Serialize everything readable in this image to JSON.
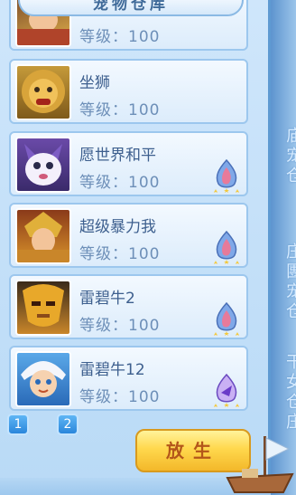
{
  "title": "宠物仓库",
  "pets": [
    {
      "name": "",
      "level": "等级：100",
      "rarity_icon": "none",
      "avatar": "golden-warrior"
    },
    {
      "name": "坐狮",
      "level": "等级：100",
      "rarity_icon": "none",
      "avatar": "guardian-lion"
    },
    {
      "name": "愿世界和平",
      "level": "等级：100",
      "rarity_icon": "flame-gem-3star",
      "avatar": "purple-fox"
    },
    {
      "name": "超级暴力我",
      "level": "等级：100",
      "rarity_icon": "flame-gem-3star",
      "avatar": "golden-armored-hero"
    },
    {
      "name": "雷碧牛2",
      "level": "等级：100",
      "rarity_icon": "flame-gem-3star",
      "avatar": "golden-bull-mask"
    },
    {
      "name": "雷碧牛12",
      "level": "等级：100",
      "rarity_icon": "purple-gem-3star",
      "avatar": "white-haired-elf"
    }
  ],
  "pager": {
    "page1": "1",
    "page2": "2"
  },
  "release_button": "放生",
  "side_text": [
    "庙\n宠\n仓",
    "庄\n團\n宠\n仓",
    "干\n女\n仓\n庄"
  ],
  "colors": {
    "panel": "#cfe6fb",
    "accent": "#3f6a99",
    "release": "#ffd84d"
  }
}
